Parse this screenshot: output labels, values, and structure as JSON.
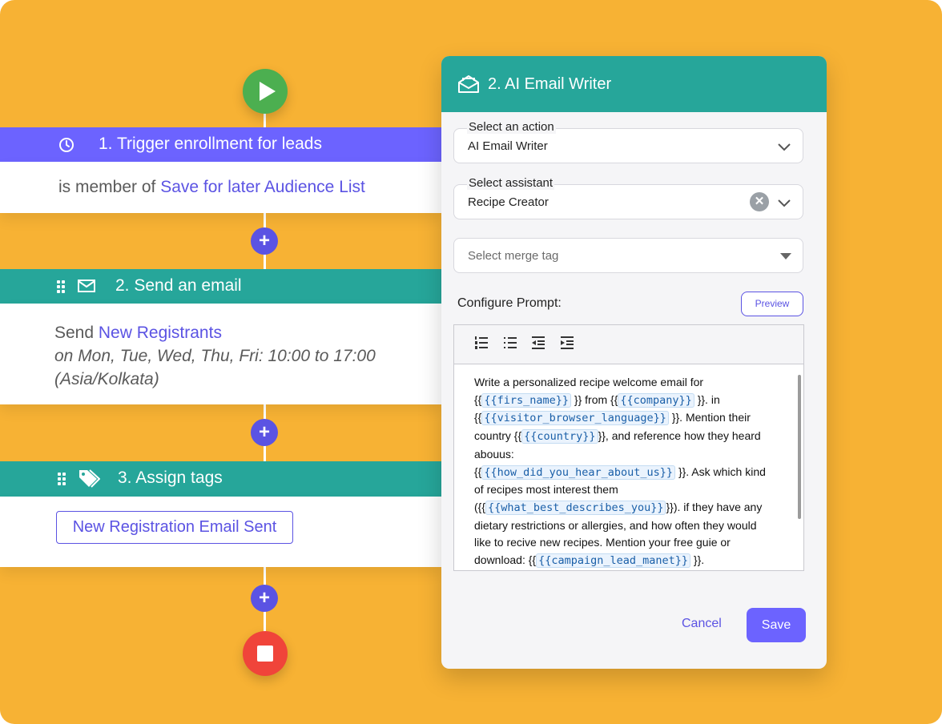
{
  "colors": {
    "background": "#F7B234",
    "accent_purple": "#6C63FF",
    "accent_teal": "#26A69A",
    "link": "#5B53E3",
    "start": "#4CAF50",
    "stop": "#F0443A"
  },
  "workflow": {
    "start_icon": "play-icon",
    "stop_icon": "stop-icon",
    "add_icon": "plus-icon",
    "trigger": {
      "title": "1. Trigger enrollment for leads",
      "icon": "clock-icon",
      "body_prefix": "is member of",
      "body_link": "Save for later Audience List"
    },
    "send_email": {
      "title": "2. Send an email",
      "icon": "envelope-icon",
      "body_prefix": "Send",
      "body_link": "New Registrants",
      "schedule": "on Mon, Tue, Wed, Thu, Fri: 10:00 to 17:00",
      "timezone": "(Asia/Kolkata)"
    },
    "assign_tags": {
      "title": "3. Assign tags",
      "icon": "tags-icon",
      "tag": "New Registration Email Sent"
    }
  },
  "panel": {
    "title": "2. AI Email Writer",
    "icon": "email-open-icon",
    "action": {
      "label": "Select an action",
      "value": "AI Email Writer"
    },
    "assistant": {
      "label": "Select assistant",
      "value": "Recipe Creator"
    },
    "merge_tag": {
      "placeholder": "Select merge tag"
    },
    "configure_label": "Configure Prompt:",
    "preview_label": "Preview",
    "toolbar": [
      "ordered-list-icon",
      "bullet-list-icon",
      "outdent-icon",
      "indent-icon"
    ],
    "prompt": {
      "t1": "Write a personalized recipe welcome email for",
      "t2": "{{",
      "tag1": "{{firs_name}}",
      "t3": " }} from {{",
      "tag2": "{{company}}",
      "t4": " }}. in",
      "t5": "{{",
      "tag3": "{{visitor_browser_language}}",
      "t6": " }}. Mention their country {{",
      "tag4": "{{country}}",
      "t7": "}}, and reference how they heard abouus:",
      "t8": " {{",
      "tag5": "{{how_did_you_hear_about_us}}",
      "t9": " }}. Ask which kind of recipes most interest them",
      "t10": " ({{",
      "tag6": "{{what_best_describes_you}}",
      "t11": "}}). if they have any dietary restrictions or allergies, and how often they would like to recive new recipes. Mention your free guie or download: {{",
      "tag7": "{{campaign_lead_manet}}",
      "t12": " }}."
    },
    "cancel_label": "Cancel",
    "save_label": "Save"
  }
}
